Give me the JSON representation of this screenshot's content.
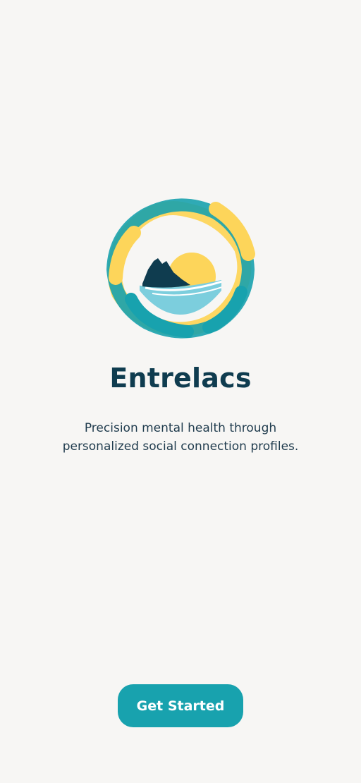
{
  "app": {
    "name": "Entrelacs",
    "tagline_line1": "Precision mental health through",
    "tagline_line2": "personalized social connection profiles."
  },
  "actions": {
    "get_started_label": "Get Started"
  },
  "logo": {
    "icon": "entrelacs-logo-icon",
    "colors": {
      "teal": "#18a2ae",
      "yellow": "#fdd55a",
      "water": "#7ccedd",
      "mountain": "#0f3c4f",
      "sun": "#fdd55a"
    }
  },
  "theme": {
    "background": "#f7f6f4",
    "title_color": "#0f3c4f",
    "button_color": "#18a2ae"
  }
}
